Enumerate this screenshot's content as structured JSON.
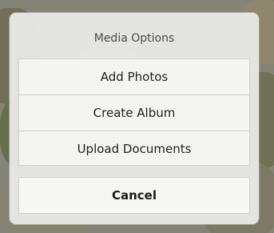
{
  "sheet": {
    "title": "Media Options",
    "options": [
      {
        "label": "Add Photos"
      },
      {
        "label": "Create Album"
      },
      {
        "label": "Upload Documents"
      }
    ],
    "cancel_label": "Cancel"
  }
}
